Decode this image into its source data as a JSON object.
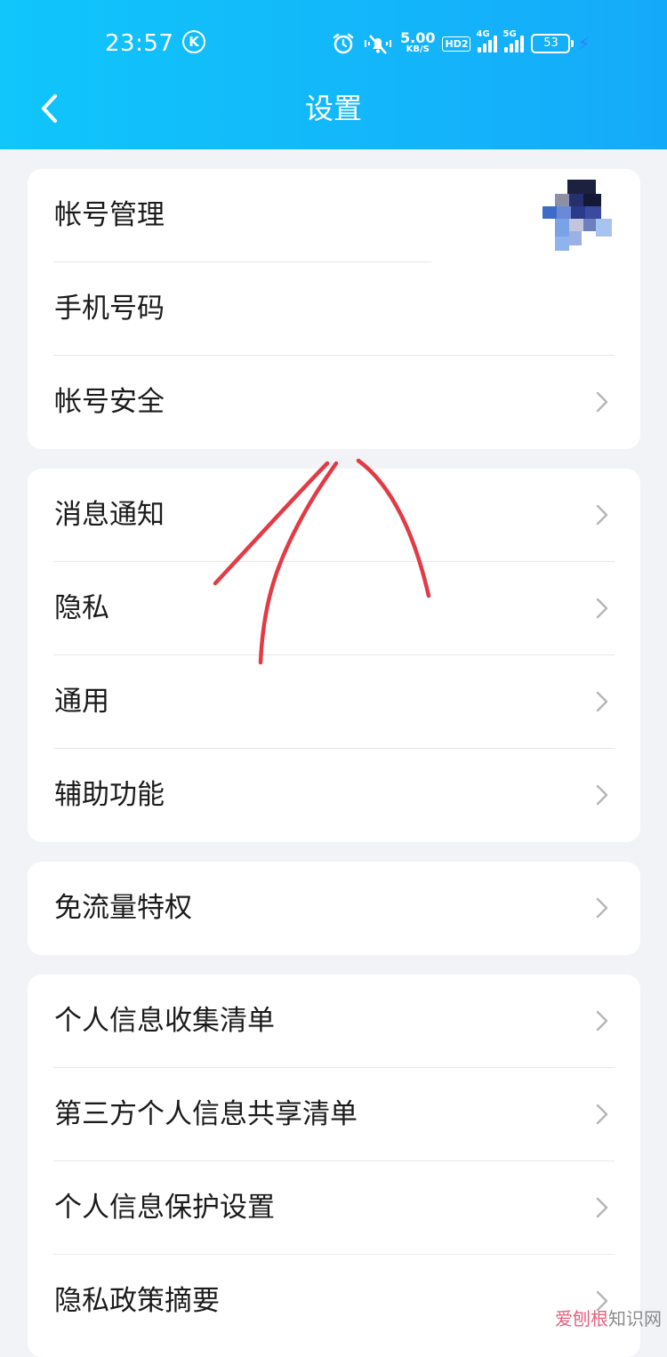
{
  "status_bar": {
    "time": "23:57",
    "k_badge": "K",
    "net_speed_value": "5.00",
    "net_speed_unit": "KB/S",
    "hd_label": "HD2",
    "sim1_label": "4G",
    "sim2_label": "5G",
    "battery_level": "53",
    "icons": [
      "alarm-icon",
      "mute-vibrate-icon",
      "hd-icon",
      "signal-4g-icon",
      "signal-5g-icon",
      "battery-icon",
      "charging-icon"
    ]
  },
  "header": {
    "title": "设置",
    "background_colors": [
      "#10c6fb",
      "#15aaf9"
    ]
  },
  "groups": [
    {
      "items": [
        {
          "label": "帐号管理",
          "trailing": "avatar"
        },
        {
          "label": "手机号码",
          "trailing": "none"
        },
        {
          "label": "帐号安全",
          "trailing": "chevron"
        }
      ]
    },
    {
      "items": [
        {
          "label": "消息通知",
          "trailing": "chevron"
        },
        {
          "label": "隐私",
          "trailing": "chevron"
        },
        {
          "label": "通用",
          "trailing": "chevron"
        },
        {
          "label": "辅助功能",
          "trailing": "chevron"
        }
      ]
    },
    {
      "items": [
        {
          "label": "免流量特权",
          "trailing": "chevron"
        }
      ]
    },
    {
      "items": [
        {
          "label": "个人信息收集清单",
          "trailing": "chevron"
        },
        {
          "label": "第三方个人信息共享清单",
          "trailing": "chevron"
        },
        {
          "label": "个人信息保护设置",
          "trailing": "chevron"
        },
        {
          "label": "隐私政策摘要",
          "trailing": "chevron"
        }
      ]
    }
  ],
  "annotation_color": "#e33b45",
  "watermark": {
    "part1": "爱刨根",
    "part2": "知识网"
  }
}
